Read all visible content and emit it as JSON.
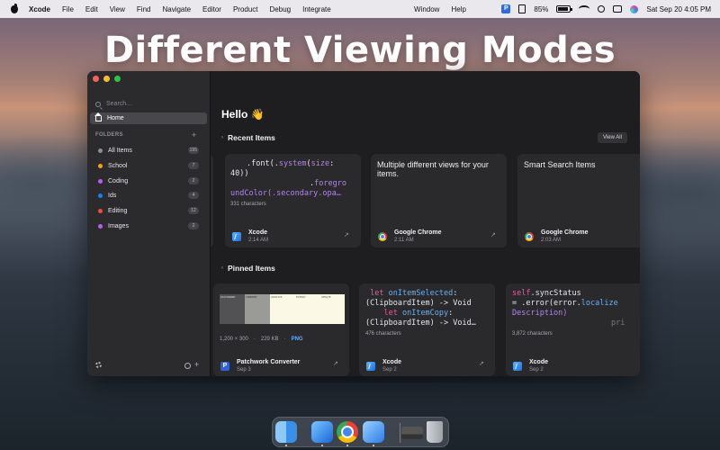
{
  "menubar": {
    "app": "Xcode",
    "items": [
      "File",
      "Edit",
      "View",
      "Find",
      "Navigate",
      "Editor",
      "Product",
      "Debug",
      "Integrate"
    ],
    "center_items": [
      "Window",
      "Help"
    ],
    "battery": "85%",
    "clock": "Sat Sep 20  4:05 PM",
    "badge_letter": "P"
  },
  "headline": "Different Viewing Modes",
  "sidebar": {
    "search_placeholder": "Search...",
    "home_label": "Home",
    "folders_heading": "FOLDERS",
    "folders": [
      {
        "label": "All Items",
        "count": "195",
        "color": "#8e8e93"
      },
      {
        "label": "School",
        "count": "7",
        "color": "#ff9f0a"
      },
      {
        "label": "Coding",
        "count": "2",
        "color": "#bf5af2"
      },
      {
        "label": "Ids",
        "count": "4",
        "color": "#0a84ff"
      },
      {
        "label": "Editing",
        "count": "12",
        "color": "#ff453a"
      },
      {
        "label": "Images",
        "count": "2",
        "color": "#bf5af2"
      }
    ]
  },
  "main": {
    "greeting": "Hello 👋",
    "recent_title": "Recent Items",
    "view_all": "View All",
    "pinned_title": "Pinned Items",
    "recent": [
      {
        "code_line1a": ".font(.",
        "code_line1b": "system",
        "code_line1c": "(",
        "code_line1d": "size",
        "code_line1e": ":",
        "code_line2": "40))",
        "code_line3a": ".",
        "code_line3b": "foregro",
        "code_line4": "undColor(.secondary.opa…",
        "meta": "331 characters",
        "app": "Xcode",
        "time": "2:14 AM"
      },
      {
        "text": "Multiple different views for your items.",
        "app": "Google Chrome",
        "time": "2:11 AM"
      },
      {
        "text": "Smart Search Items",
        "app": "Google Chrome",
        "time": "2:03 AM"
      }
    ],
    "pinned": [
      {
        "meta_size": "1,200 × 300",
        "meta_bytes": "229 KB",
        "meta_type": "PNG",
        "app": "Patchwork Converter",
        "time": "Sep 3",
        "thumb_labels": [
          "PATCHWORK",
          "CONVERT",
          "ARCHIVE",
          "EXPORT",
          "UPDATE"
        ]
      },
      {
        "kw1": "let",
        "fn1": "onItemSelected",
        "rest1": ":",
        "line2": "(ClipboardItem) -> Void",
        "kw2": "let",
        "fn2": "onItemCopy",
        "rest2": ":",
        "line4": "(ClipboardItem) -> Void…",
        "meta": "476 characters",
        "app": "Xcode",
        "time": "Sep 2"
      },
      {
        "kw1": "self",
        "rest1": ".syncStatus",
        "line2a": "= .error(error.",
        "line2b": "localize",
        "line3": "Description)",
        "line4": "pri",
        "meta": "3,872 characters",
        "app": "Xcode",
        "time": "Sep 2"
      }
    ]
  },
  "dock": {
    "apps": [
      "finder-icon",
      "xcode-icon",
      "chrome-icon",
      "xcode-alt-icon",
      "display-icon",
      "trash-icon"
    ]
  }
}
